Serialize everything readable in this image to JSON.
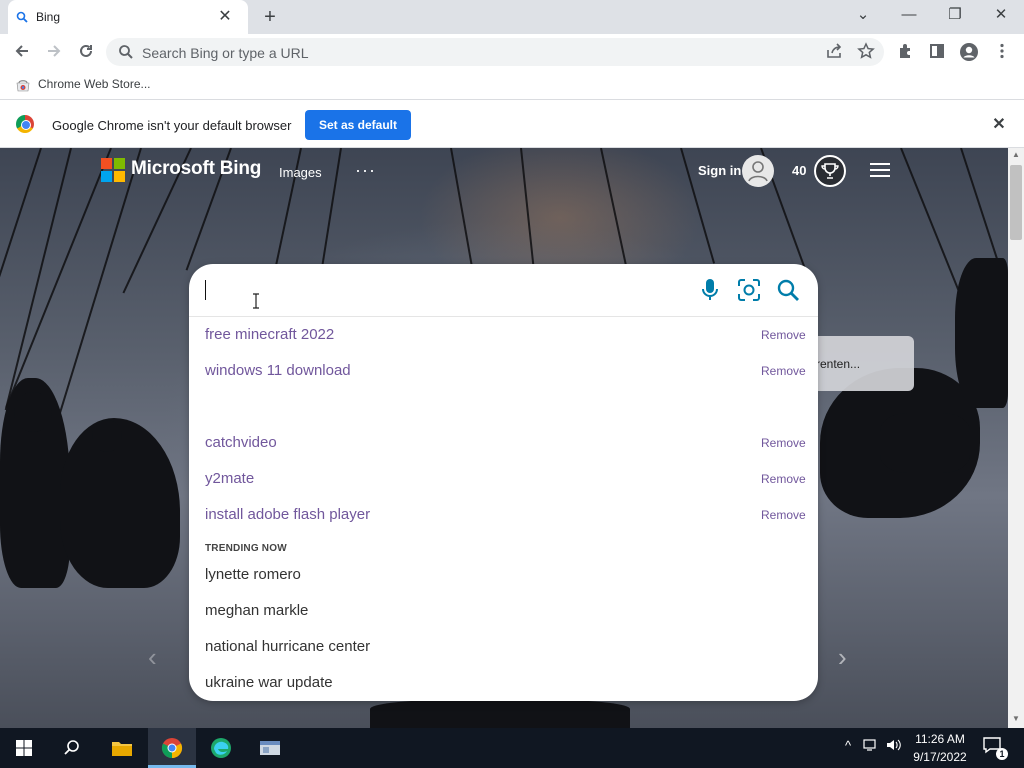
{
  "browser": {
    "tab": {
      "title": "Bing",
      "favicon": "search-icon",
      "close": "✕"
    },
    "new_tab": "+",
    "window_controls": {
      "dropdown": "⌄",
      "minimize": "—",
      "restore": "❐",
      "close": "✕"
    },
    "omnibox": {
      "placeholder": "Search Bing or type a URL",
      "icon": "search-icon"
    },
    "toolbar_icons": [
      "back-arrow-icon",
      "forward-arrow-icon",
      "reload-icon",
      "share-icon",
      "star-icon",
      "extensions-icon",
      "side-panel-icon",
      "profile-icon",
      "menu-dots-icon"
    ],
    "bookmarks": [
      {
        "label": "Chrome Web Store..."
      }
    ],
    "infobar": {
      "message": "Google Chrome isn't your default browser",
      "button": "Set as default",
      "close": "✕"
    }
  },
  "bing": {
    "logo_text": "Microsoft Bing",
    "nav": {
      "images": "Images",
      "more": "···"
    },
    "sign_in": "Sign in",
    "points": "40",
    "bg_card_text": "renten...",
    "search": {
      "value": "",
      "history": [
        {
          "text": "free minecraft 2022",
          "action": "Remove"
        },
        {
          "text": "windows 11 download",
          "action": "Remove"
        },
        {
          "text": "catchvideo",
          "action": "Remove"
        },
        {
          "text": "y2mate",
          "action": "Remove"
        },
        {
          "text": "install adobe flash player",
          "action": "Remove"
        }
      ],
      "trending_label": "TRENDING NOW",
      "trending": [
        {
          "text": "lynette romero"
        },
        {
          "text": "meghan markle"
        },
        {
          "text": "national hurricane center"
        },
        {
          "text": "ukraine war update"
        }
      ]
    }
  },
  "taskbar": {
    "items": [
      "windows-start-icon",
      "search-icon",
      "file-explorer-icon",
      "chrome-icon",
      "edge-icon",
      "app-window-icon"
    ],
    "time": "11:26 AM",
    "date": "9/17/2022",
    "notification_count": "1"
  },
  "colors": {
    "accent": "#1a73e8",
    "suggestion_visited": "#71579c",
    "bing_teal": "#007daa",
    "taskbar": "#101722"
  }
}
